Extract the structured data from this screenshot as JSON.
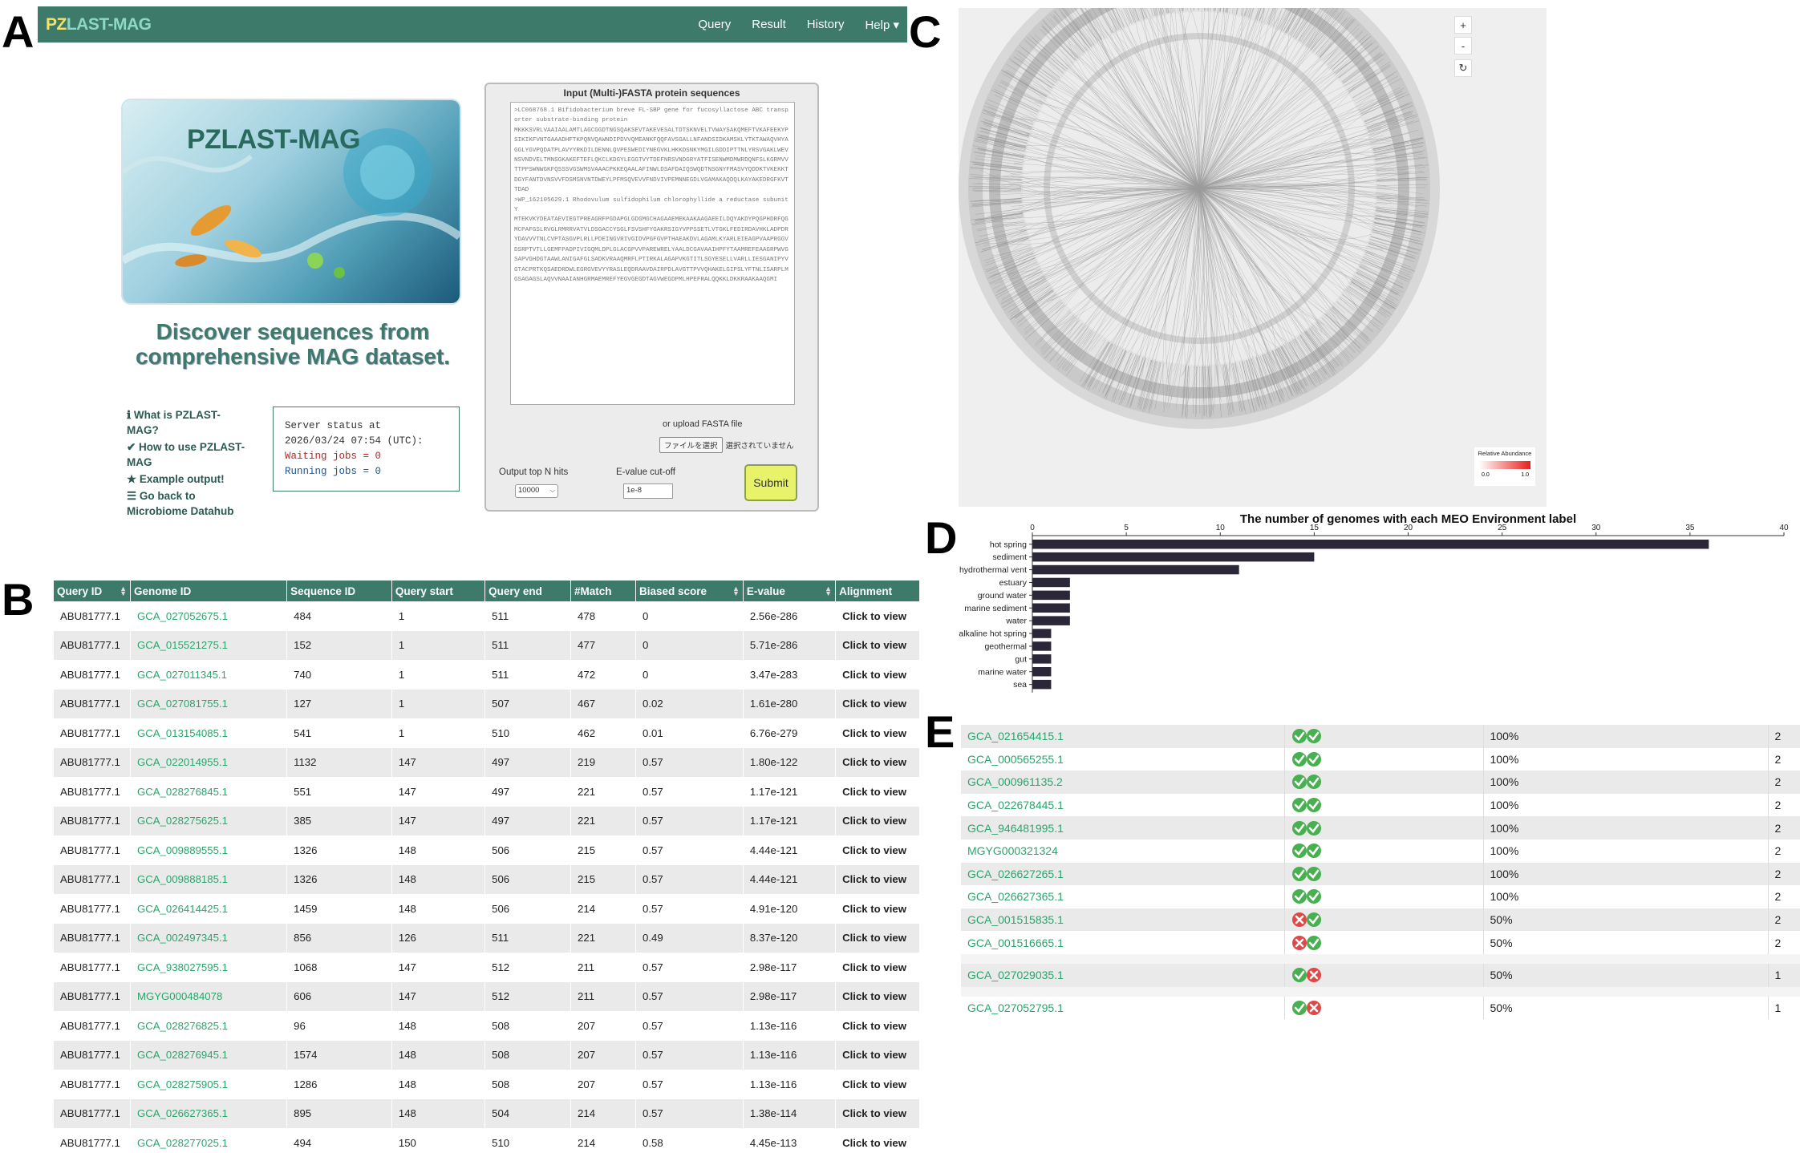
{
  "panel_labels": {
    "a": "A",
    "b": "B",
    "c": "C",
    "d": "D",
    "e": "E"
  },
  "app": {
    "brand_prefix": "PZ",
    "brand_rest": "LAST-MAG",
    "nav": [
      "Query",
      "Result",
      "History",
      "Help ▾"
    ]
  },
  "hero": {
    "title": "PZLAST-MAG"
  },
  "tagline": "Discover sequences from comprehensive MAG dataset.",
  "sidelinks": [
    "ℹ What is PZLAST-MAG?",
    "✔ How to use PZLAST-MAG",
    "★ Example output!",
    "☰ Go back to Microbiome Datahub"
  ],
  "status": {
    "line1": "Server status at",
    "line2": "2026/03/24 07:54 (UTC):",
    "waiting": "Waiting jobs = 0",
    "running": "Running jobs = 0"
  },
  "input": {
    "title": "Input (Multi-)FASTA protein sequences",
    "sequence": ">LC068768.1 Bifidobacterium breve FL-SBP gene for fucosyllactose ABC transporter substrate-binding protein\nMKKKSVRLVAAIAALAMTLAGCGGDTNGSQAKSEVTAKEVESALTDTSKNVELTVWAYSAKQMEFTVKAFEEKYPSIKIKFVNTGAAADHFTKPQNVQAWNDIPDVVQMEANKFQQFAVSGALLNFANDSIDKAMSKLYTKTAWAQVHYAGGLYGVPQDATPLAVYYRKDILDENNLQVPESWEDIYNEGVKLHKKDSNKYMGILGDDIPTTNLYRSVGAKLWEVNSVNDVELTMNSGKAKEFTEFLQKCLKDGYLEGGTVYTDEFNRSVNDGRYATFISENWMDMWRDQNFSLKGRMVVTTPPSWNWGKFQSSSVGSWMSVAAACPKKEQAALAFINWLDSAFDAIQSWQDTNSGNYFMASVYQDDKTVKEKKTDGYFANTDVNSVVFDSMSNVNTDWEYLPFMSQVEVVFNDVIVPEMNNEGDLVGAMAKAQDQLKAYAKEDRGFKVTTDAD\n>WP_162105629.1 Rhodovulum sulfidophilum chlorophyllide a reductase subunit Y\nMTEKVKYDEATAEVIEGTPREAGRFPGDAPGLGDGMGCHAGAAEMEKAAKAAGAEEILDQYAKDYPQGPHDRFQGMCPAFGSLRVGLRMRRVATVLDSGACCYSGLFSVSHFYGAKRSIGYVPPSSETLVTGKLFEDIRDAVHKLADPDRYDAVVVTNLCVPTASGVPLRLLPDEINGVRIVGIDVPGFGVPTHAEAKDVLAGAMLKYARLEIEAGPVAAPRGGVDSRPTVTLLGEMFPADPIVIGQMLDPLGLACGPVVPAREWRELYAALDCGAVAAIHPFYTAAMREFEAAGRPWVGSAPVGHDGTAAWLANIGAFGLSADKVRAAQMRFLPTIRKALAGAPVKGTITLSGYESELLVARLLIESGANIPYVGTACPRTKQSAEDRDWLEGRGVEVYYRASLEQDRAAVDAIRPDLAVGTTPVVQHAKELGIPSLYFTNLISARPLMGSAGAGSLAQVVNAAIANHGRMAEMREFYEGVGEGDTAGVWEGDPMLHPEFRALQQKKLDKKRAAKAAQGMI",
    "upload_label": "or upload FASTA file",
    "file_button": "ファイルを選択",
    "file_status": "選択されていません",
    "topn_label": "Output top N hits",
    "topn_value": "10000",
    "evalue_label": "E-value cut-off",
    "evalue_value": "1e-8",
    "submit": "Submit"
  },
  "results": {
    "headers": [
      "Query ID",
      "Genome ID",
      "Sequence ID",
      "Query start",
      "Query end",
      "#Match",
      "Biased score",
      "E-value",
      "Alignment"
    ],
    "rows": [
      [
        "ABU81777.1",
        "GCA_027052675.1",
        "484",
        "1",
        "511",
        "478",
        "0",
        "2.56e-286",
        "Click to view"
      ],
      [
        "ABU81777.1",
        "GCA_015521275.1",
        "152",
        "1",
        "511",
        "477",
        "0",
        "5.71e-286",
        "Click to view"
      ],
      [
        "ABU81777.1",
        "GCA_027011345.1",
        "740",
        "1",
        "511",
        "472",
        "0",
        "3.47e-283",
        "Click to view"
      ],
      [
        "ABU81777.1",
        "GCA_027081755.1",
        "127",
        "1",
        "507",
        "467",
        "0.02",
        "1.61e-280",
        "Click to view"
      ],
      [
        "ABU81777.1",
        "GCA_013154085.1",
        "541",
        "1",
        "510",
        "462",
        "0.01",
        "6.76e-279",
        "Click to view"
      ],
      [
        "ABU81777.1",
        "GCA_022014955.1",
        "1132",
        "147",
        "497",
        "219",
        "0.57",
        "1.80e-122",
        "Click to view"
      ],
      [
        "ABU81777.1",
        "GCA_028276845.1",
        "551",
        "147",
        "497",
        "221",
        "0.57",
        "1.17e-121",
        "Click to view"
      ],
      [
        "ABU81777.1",
        "GCA_028275625.1",
        "385",
        "147",
        "497",
        "221",
        "0.57",
        "1.17e-121",
        "Click to view"
      ],
      [
        "ABU81777.1",
        "GCA_009889555.1",
        "1326",
        "148",
        "506",
        "215",
        "0.57",
        "4.44e-121",
        "Click to view"
      ],
      [
        "ABU81777.1",
        "GCA_009888185.1",
        "1326",
        "148",
        "506",
        "215",
        "0.57",
        "4.44e-121",
        "Click to view"
      ],
      [
        "ABU81777.1",
        "GCA_026414425.1",
        "1459",
        "148",
        "506",
        "214",
        "0.57",
        "4.91e-120",
        "Click to view"
      ],
      [
        "ABU81777.1",
        "GCA_002497345.1",
        "856",
        "126",
        "511",
        "221",
        "0.49",
        "8.37e-120",
        "Click to view"
      ],
      [
        "ABU81777.1",
        "GCA_938027595.1",
        "1068",
        "147",
        "512",
        "211",
        "0.57",
        "2.98e-117",
        "Click to view"
      ],
      [
        "ABU81777.1",
        "MGYG000484078",
        "606",
        "147",
        "512",
        "211",
        "0.57",
        "2.98e-117",
        "Click to view"
      ],
      [
        "ABU81777.1",
        "GCA_028276825.1",
        "96",
        "148",
        "508",
        "207",
        "0.57",
        "1.13e-116",
        "Click to view"
      ],
      [
        "ABU81777.1",
        "GCA_028276945.1",
        "1574",
        "148",
        "508",
        "207",
        "0.57",
        "1.13e-116",
        "Click to view"
      ],
      [
        "ABU81777.1",
        "GCA_028275905.1",
        "1286",
        "148",
        "508",
        "207",
        "0.57",
        "1.13e-116",
        "Click to view"
      ],
      [
        "ABU81777.1",
        "GCA_026627365.1",
        "895",
        "148",
        "504",
        "214",
        "0.57",
        "1.38e-114",
        "Click to view"
      ],
      [
        "ABU81777.1",
        "GCA_028277025.1",
        "494",
        "150",
        "510",
        "214",
        "0.58",
        "4.45e-113",
        "Click to view"
      ]
    ]
  },
  "tree": {
    "zoom_in": "+",
    "zoom_out": "-",
    "reset": "↻",
    "legend_title": "Relative Abundance",
    "legend_lo": "0.0",
    "legend_hi": "1.0"
  },
  "chart_data": {
    "type": "bar",
    "orientation": "horizontal",
    "title": "The number of genomes with each MEO Environment label",
    "categories": [
      "hot spring",
      "sediment",
      "hydrothermal vent",
      "estuary",
      "ground water",
      "marine sediment",
      "water",
      "alkaline hot spring",
      "geothermal",
      "gut",
      "marine water",
      "sea"
    ],
    "values": [
      36,
      15,
      11,
      2,
      2,
      2,
      2,
      1,
      1,
      1,
      1,
      1
    ],
    "xlim": [
      0,
      40
    ],
    "xticks": [
      0,
      5,
      10,
      15,
      20,
      25,
      30,
      35,
      40
    ],
    "bar_color": "#2b2638"
  },
  "presence": {
    "rows": [
      {
        "id": "GCA_021654415.1",
        "marks": [
          "ok",
          "ok"
        ],
        "pct": "100%",
        "n": "2"
      },
      {
        "id": "GCA_000565255.1",
        "marks": [
          "ok",
          "ok"
        ],
        "pct": "100%",
        "n": "2"
      },
      {
        "id": "GCA_000961135.2",
        "marks": [
          "ok",
          "ok"
        ],
        "pct": "100%",
        "n": "2"
      },
      {
        "id": "GCA_022678445.1",
        "marks": [
          "ok",
          "ok"
        ],
        "pct": "100%",
        "n": "2"
      },
      {
        "id": "GCA_946481995.1",
        "marks": [
          "ok",
          "ok"
        ],
        "pct": "100%",
        "n": "2"
      },
      {
        "id": "MGYG000321324",
        "marks": [
          "ok",
          "ok"
        ],
        "pct": "100%",
        "n": "2"
      },
      {
        "id": "GCA_026627265.1",
        "marks": [
          "ok",
          "ok"
        ],
        "pct": "100%",
        "n": "2"
      },
      {
        "id": "GCA_026627365.1",
        "marks": [
          "ok",
          "ok"
        ],
        "pct": "100%",
        "n": "2"
      },
      {
        "id": "GCA_001515835.1",
        "marks": [
          "no",
          "ok"
        ],
        "pct": "50%",
        "n": "2"
      },
      {
        "id": "GCA_001516665.1",
        "marks": [
          "no",
          "ok"
        ],
        "pct": "50%",
        "n": "2"
      },
      {
        "id": "GCA_027029035.1",
        "marks": [
          "ok",
          "no"
        ],
        "pct": "50%",
        "n": "1"
      },
      {
        "id": "GCA_027052795.1",
        "marks": [
          "ok",
          "no"
        ],
        "pct": "50%",
        "n": "1"
      }
    ]
  }
}
